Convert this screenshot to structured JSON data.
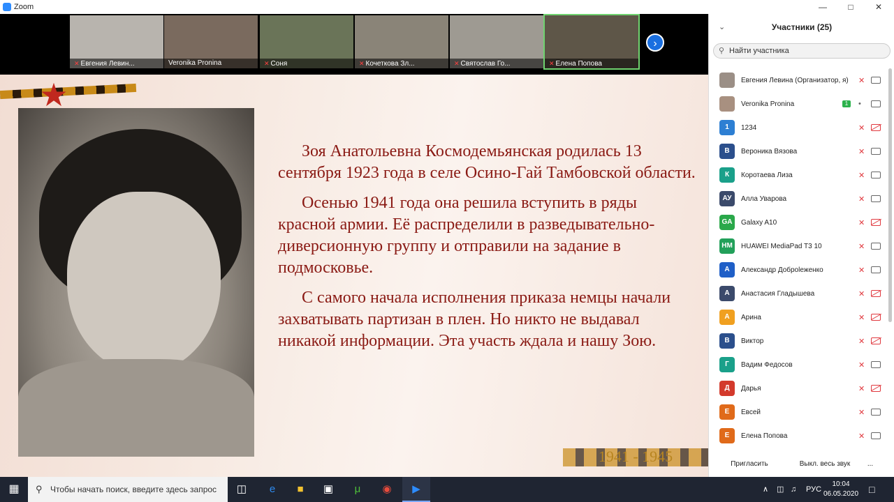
{
  "window": {
    "title": "Zoom"
  },
  "thumbnails": [
    {
      "name": "Евгения Левин...",
      "muted": true,
      "bg": "#b8b4ae"
    },
    {
      "name": "Veronika Pronina",
      "muted": false,
      "bg": "#7a6a5e"
    },
    {
      "name": "Соня",
      "muted": true,
      "bg": "#6a7458"
    },
    {
      "name": "Кочеткова Зл...",
      "muted": true,
      "bg": "#8a8478"
    },
    {
      "name": "Святослав Го...",
      "muted": true,
      "bg": "#9e9a92"
    },
    {
      "name": "Елена Попова",
      "muted": true,
      "bg": "#5e5648",
      "active": true
    }
  ],
  "slide": {
    "paragraphs": [
      "Зоя Анатольевна Космодемьянская родилась 13 сентября 1923 года в селе Осино-Гай Тамбовской области.",
      "Осенью 1941 года она решила вступить в ряды красной армии. Её распределили в разведывательно-диверсионную группу и отправили на задание в подмосковье.",
      "С самого начала исполнения приказа немцы начали захватывать партизан в плен. Но никто не выдавал никакой информации. Эта участь ждала и нашу Зою."
    ],
    "years": "1941 - 1945"
  },
  "panel": {
    "title": "Участники (25)",
    "search_placeholder": "Найти участника",
    "participants": [
      {
        "name": "Евгения Левина (Организатор, я)",
        "initials": "",
        "color": "#9b8f86",
        "mic": "muted",
        "cam": "on"
      },
      {
        "name": "Veronika Pronina",
        "initials": "",
        "color": "#a89080",
        "mic": "on",
        "cam": "on",
        "badge": "1"
      },
      {
        "name": "1234",
        "initials": "1",
        "color": "#2d7fd3",
        "mic": "muted",
        "cam": "off"
      },
      {
        "name": "Вероника Вязова",
        "initials": "В",
        "color": "#2b4f8c",
        "mic": "muted",
        "cam": "on"
      },
      {
        "name": "Коротаева Лиза",
        "initials": "К",
        "color": "#1aa08a",
        "mic": "muted",
        "cam": "on"
      },
      {
        "name": "Алла Уварова",
        "initials": "АУ",
        "color": "#3b4a6b",
        "mic": "muted",
        "cam": "on"
      },
      {
        "name": "Galaxy A10",
        "initials": "GA",
        "color": "#2aa84a",
        "mic": "muted",
        "cam": "off"
      },
      {
        "name": "HUAWEI MediaPad T3 10",
        "initials": "HM",
        "color": "#22a05a",
        "mic": "muted",
        "cam": "on"
      },
      {
        "name": "Александр Доброleженко",
        "initials": "А",
        "color": "#1f5fc7",
        "mic": "muted",
        "cam": "on"
      },
      {
        "name": "Анастасия Гладышева",
        "initials": "А",
        "color": "#3b4a6b",
        "mic": "muted",
        "cam": "off"
      },
      {
        "name": "Арина",
        "initials": "А",
        "color": "#f0a020",
        "mic": "muted",
        "cam": "off"
      },
      {
        "name": "Виктор",
        "initials": "В",
        "color": "#2b4f8c",
        "mic": "muted",
        "cam": "off"
      },
      {
        "name": "Вадим Федосов",
        "initials": "Г",
        "color": "#1aa08a",
        "mic": "muted",
        "cam": "on"
      },
      {
        "name": "Дарья",
        "initials": "Д",
        "color": "#d33a2c",
        "mic": "muted",
        "cam": "off"
      },
      {
        "name": "Евсей",
        "initials": "Е",
        "color": "#e06a1a",
        "mic": "muted",
        "cam": "on"
      },
      {
        "name": "Елена Попова",
        "initials": "Е",
        "color": "#e06a1a",
        "mic": "muted",
        "cam": "on"
      }
    ],
    "invite_label": "Пригласить",
    "mute_all_label": "Выкл. весь звук",
    "more_label": "..."
  },
  "taskbar": {
    "search_placeholder": "Чтобы начать поиск, введите здесь запрос",
    "lang": "РУС",
    "time": "10:04",
    "date": "06.05.2020"
  }
}
